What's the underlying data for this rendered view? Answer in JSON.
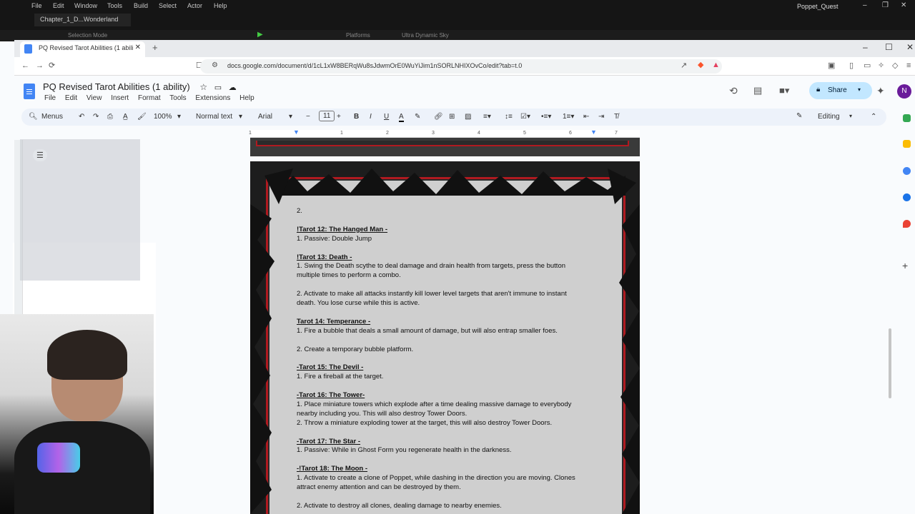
{
  "ue": {
    "menu": [
      "File",
      "Edit",
      "Window",
      "Tools",
      "Build",
      "Select",
      "Actor",
      "Help"
    ],
    "project": "Poppet_Quest",
    "level_tab": "Chapter_1_D...Wonderland",
    "toolbar": {
      "mode": "Selection Mode",
      "platforms": "Platforms",
      "sky": "Ultra Dynamic Sky"
    }
  },
  "browser": {
    "tab_title": "PQ Revised Tarot Abilities (1 abili",
    "url": "docs.google.com/document/d/1cL1xW8BERqWu8sJdwmOrE0WuYiJim1nSORLNHIXOvCo/edit?tab=t.0"
  },
  "doc": {
    "title": "PQ Revised Tarot Abilities (1 ability)",
    "menu": [
      "File",
      "Edit",
      "View",
      "Insert",
      "Format",
      "Tools",
      "Extensions",
      "Help"
    ],
    "share_label": "Share",
    "avatar_initial": "N",
    "toolbar": {
      "menus": "Menus",
      "zoom": "100%",
      "style": "Normal text",
      "font": "Arial",
      "font_size": "11",
      "mode": "Editing"
    },
    "ruler_marks": [
      "1",
      "1",
      "2",
      "3",
      "4",
      "5",
      "6",
      "7"
    ],
    "lines": [
      {
        "text": "2.",
        "h": false
      },
      {
        "text": "",
        "h": false
      },
      {
        "text": "!Tarot 12: The Hanged Man -",
        "h": true
      },
      {
        "text": "1. Passive: Double Jump",
        "h": false
      },
      {
        "text": "",
        "h": false
      },
      {
        "text": "!Tarot 13: Death -",
        "h": true
      },
      {
        "text": "1. Swing the Death scythe to deal damage and drain health from targets, press the  button",
        "h": false
      },
      {
        "text": "multiple times to perform a combo.",
        "h": false
      },
      {
        "text": "",
        "h": false
      },
      {
        "text": "2. Activate to make all attacks instantly kill lower level targets that aren't immune to instant",
        "h": false
      },
      {
        "text": "death. You lose curse while this is active.",
        "h": false
      },
      {
        "text": "",
        "h": false
      },
      {
        "text": "Tarot 14: Temperance -",
        "h": true
      },
      {
        "text": "1. Fire a bubble that deals a small amount of damage, but will also entrap smaller foes.",
        "h": false
      },
      {
        "text": "",
        "h": false
      },
      {
        "text": "2. Create a temporary bubble platform.",
        "h": false
      },
      {
        "text": "",
        "h": false
      },
      {
        "text": "-Tarot 15: The Devil -",
        "h": true
      },
      {
        "text": "1. Fire a fireball at the target.",
        "h": false
      },
      {
        "text": "",
        "h": false
      },
      {
        "text": "-Tarot 16: The Tower-",
        "h": true
      },
      {
        "text": "1. Place miniature towers which explode after a time dealing massive damage to everybody",
        "h": false
      },
      {
        "text": "nearby including you. This will also destroy Tower Doors.",
        "h": false
      },
      {
        "text": "2. Throw a miniature exploding tower at the target, this will also destroy Tower Doors.",
        "h": false
      },
      {
        "text": "",
        "h": false
      },
      {
        "text": "-Tarot 17: The Star -",
        "h": true
      },
      {
        "text": "1. Passive: While in Ghost Form you regenerate health in the darkness.",
        "h": false
      },
      {
        "text": "",
        "h": false
      },
      {
        "text": "-!Tarot 18: The Moon -",
        "h": true
      },
      {
        "text": "1. Activate to create a clone of Poppet, while dashing in the direction you are moving. Clones",
        "h": false
      },
      {
        "text": "attract enemy attention and can be destroyed by them.",
        "h": false
      },
      {
        "text": "",
        "h": false
      },
      {
        "text": "2. Activate to destroy all clones, dealing damage to nearby enemies.",
        "h": false
      }
    ]
  },
  "colors": {
    "accent": "#c2e7ff",
    "border_red": "#b01a20"
  }
}
